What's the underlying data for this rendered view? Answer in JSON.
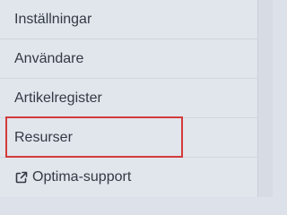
{
  "menu": {
    "items": [
      {
        "label": "Inställningar"
      },
      {
        "label": "Användare"
      },
      {
        "label": "Artikelregister"
      },
      {
        "label": "Resurser",
        "highlighted": true
      },
      {
        "label": "Optima-support",
        "icon": "external-link-icon"
      }
    ]
  },
  "colors": {
    "background": "#e1e5ec",
    "text": "#333a45",
    "highlight": "#d33b3b"
  }
}
